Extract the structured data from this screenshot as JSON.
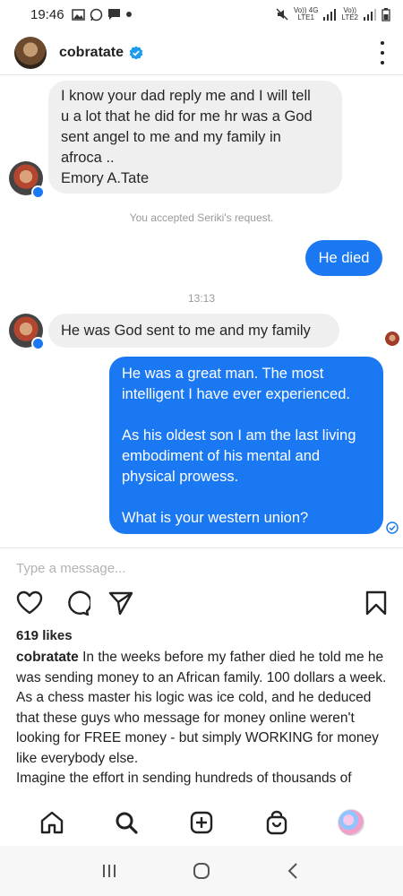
{
  "status_bar": {
    "time": "19:46",
    "network_1": "Vo)) 4G",
    "network_1_sub": "LTE1",
    "network_2": "Vo))",
    "network_2_sub": "LTE2"
  },
  "header": {
    "username": "cobratate",
    "verified": true
  },
  "messages": {
    "m1_lines": [
      "I know your dad reply me and I will tell",
      "u a lot that he did for me hr was a God",
      "sent angel to me and my family in",
      "afroca ..",
      "Emory A.Tate"
    ],
    "system_note": "You accepted Seriki's request.",
    "m2": "He died",
    "timestamp": "13:13",
    "m3": "He was God sent to me and my family",
    "m4_lines": [
      "He was a great man. The most",
      "intelligent I have ever experienced.",
      "",
      "As his oldest son I am the last living",
      "embodiment of his mental and",
      "physical prowess.",
      "",
      "What is your western union?"
    ]
  },
  "composer": {
    "placeholder": "Type a message..."
  },
  "post": {
    "likes": "619 likes",
    "username": "cobratate",
    "caption_first": " In the weeks before my father died he told me he was sending money to an African family. 100 dollars a week.",
    "caption_p2": "As a chess master his logic was ice cold, and he deduced that these guys who message for money online weren't looking for FREE money - but simply WORKING for money like everybody else.",
    "caption_p3": "Imagine the effort in sending hundreds of thousands of"
  },
  "colors": {
    "outgoing_bubble": "#1a78f2",
    "incoming_bubble": "#efefef"
  }
}
